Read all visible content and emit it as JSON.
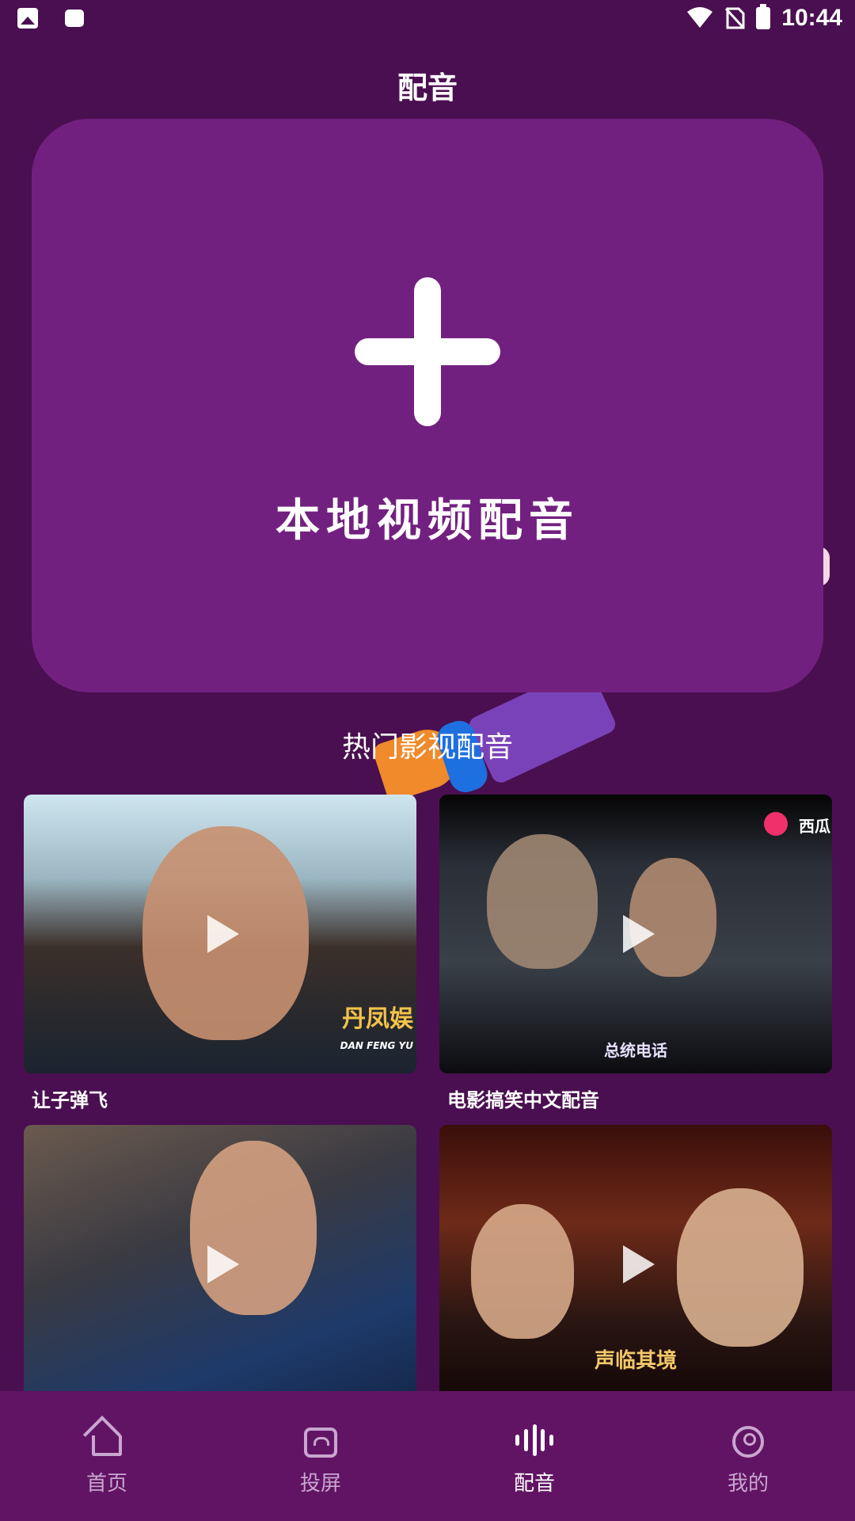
{
  "status_bar": {
    "time": "10:44"
  },
  "header": {
    "title": "配音"
  },
  "upload_card": {
    "label": "本地视频配音"
  },
  "section": {
    "title": "热门影视配音"
  },
  "videos": [
    {
      "caption": "让子弹飞",
      "overlay": "丹凤娱",
      "overlay_sub": "DAN FENG YU"
    },
    {
      "caption": "电影搞笑中文配音",
      "overlay": "总统电话",
      "badge": "西瓜"
    },
    {
      "caption": ""
    },
    {
      "caption": "",
      "overlay": "声临其境"
    }
  ],
  "nav": {
    "items": [
      {
        "label": "首页",
        "icon": "home-icon",
        "active": false
      },
      {
        "label": "投屏",
        "icon": "cast-icon",
        "active": false
      },
      {
        "label": "配音",
        "icon": "sound-wave-icon",
        "active": true
      },
      {
        "label": "我的",
        "icon": "user-icon",
        "active": false
      }
    ]
  }
}
